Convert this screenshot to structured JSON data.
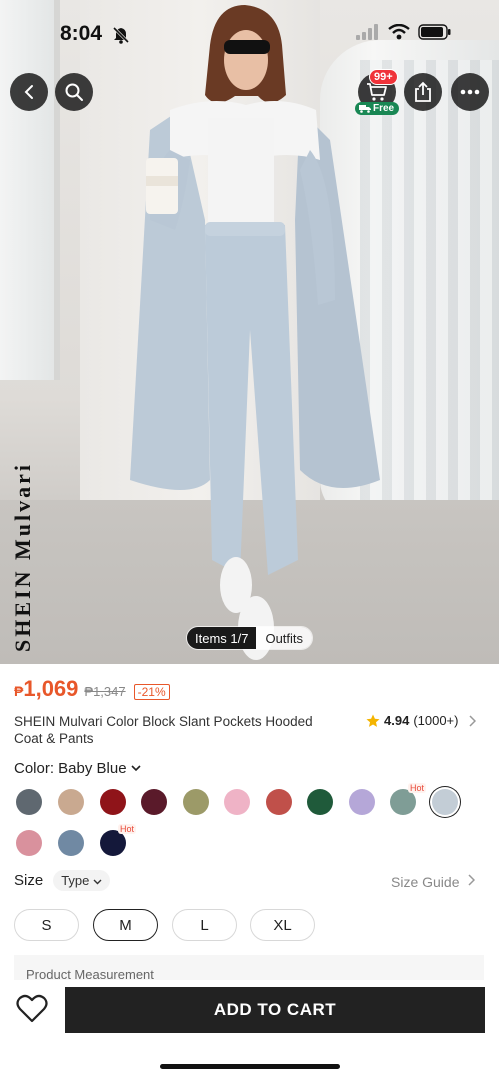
{
  "status_bar": {
    "time": "8:04"
  },
  "header": {
    "cart_count": "99+",
    "free_label": "Free"
  },
  "image": {
    "watermark": "SHEIN Mulvari",
    "pager_items": "Items 1/7",
    "pager_outfits": "Outfits"
  },
  "product": {
    "currency": "₱",
    "price": "1,069",
    "original_price": "₱1,347",
    "discount": "-21%",
    "title": "SHEIN Mulvari Color Block Slant Pockets Hooded Coat & Pants",
    "rating_value": "4.94",
    "rating_count": "(1000+)"
  },
  "color": {
    "label": "Color: Baby Blue",
    "swatches": [
      {
        "name": "slate-grey",
        "hex": "#5f6870"
      },
      {
        "name": "khaki",
        "hex": "#c9a990"
      },
      {
        "name": "burgundy",
        "hex": "#8f1419"
      },
      {
        "name": "maroon",
        "hex": "#5a1a2a"
      },
      {
        "name": "olive",
        "hex": "#9c9a68"
      },
      {
        "name": "pink",
        "hex": "#efb3c6"
      },
      {
        "name": "brick",
        "hex": "#c0504a"
      },
      {
        "name": "dark-green",
        "hex": "#1f5a3a"
      },
      {
        "name": "lilac",
        "hex": "#b5a7d8"
      },
      {
        "name": "sage",
        "hex": "#7f9d96",
        "hot": "Hot"
      },
      {
        "name": "baby-blue",
        "hex": "#c3cdd6",
        "selected": true
      },
      {
        "name": "dusty-pink",
        "hex": "#d9919d"
      },
      {
        "name": "dusty-blue",
        "hex": "#7089a3"
      },
      {
        "name": "navy",
        "hex": "#14183a",
        "hot": "Hot"
      }
    ]
  },
  "size": {
    "label": "Size",
    "type_label": "Type",
    "guide_label": "Size Guide",
    "options": [
      "S",
      "M",
      "L",
      "XL"
    ],
    "selected": "M"
  },
  "measurement": {
    "label": "Product Measurement"
  },
  "actions": {
    "add_to_cart": "ADD TO CART"
  }
}
